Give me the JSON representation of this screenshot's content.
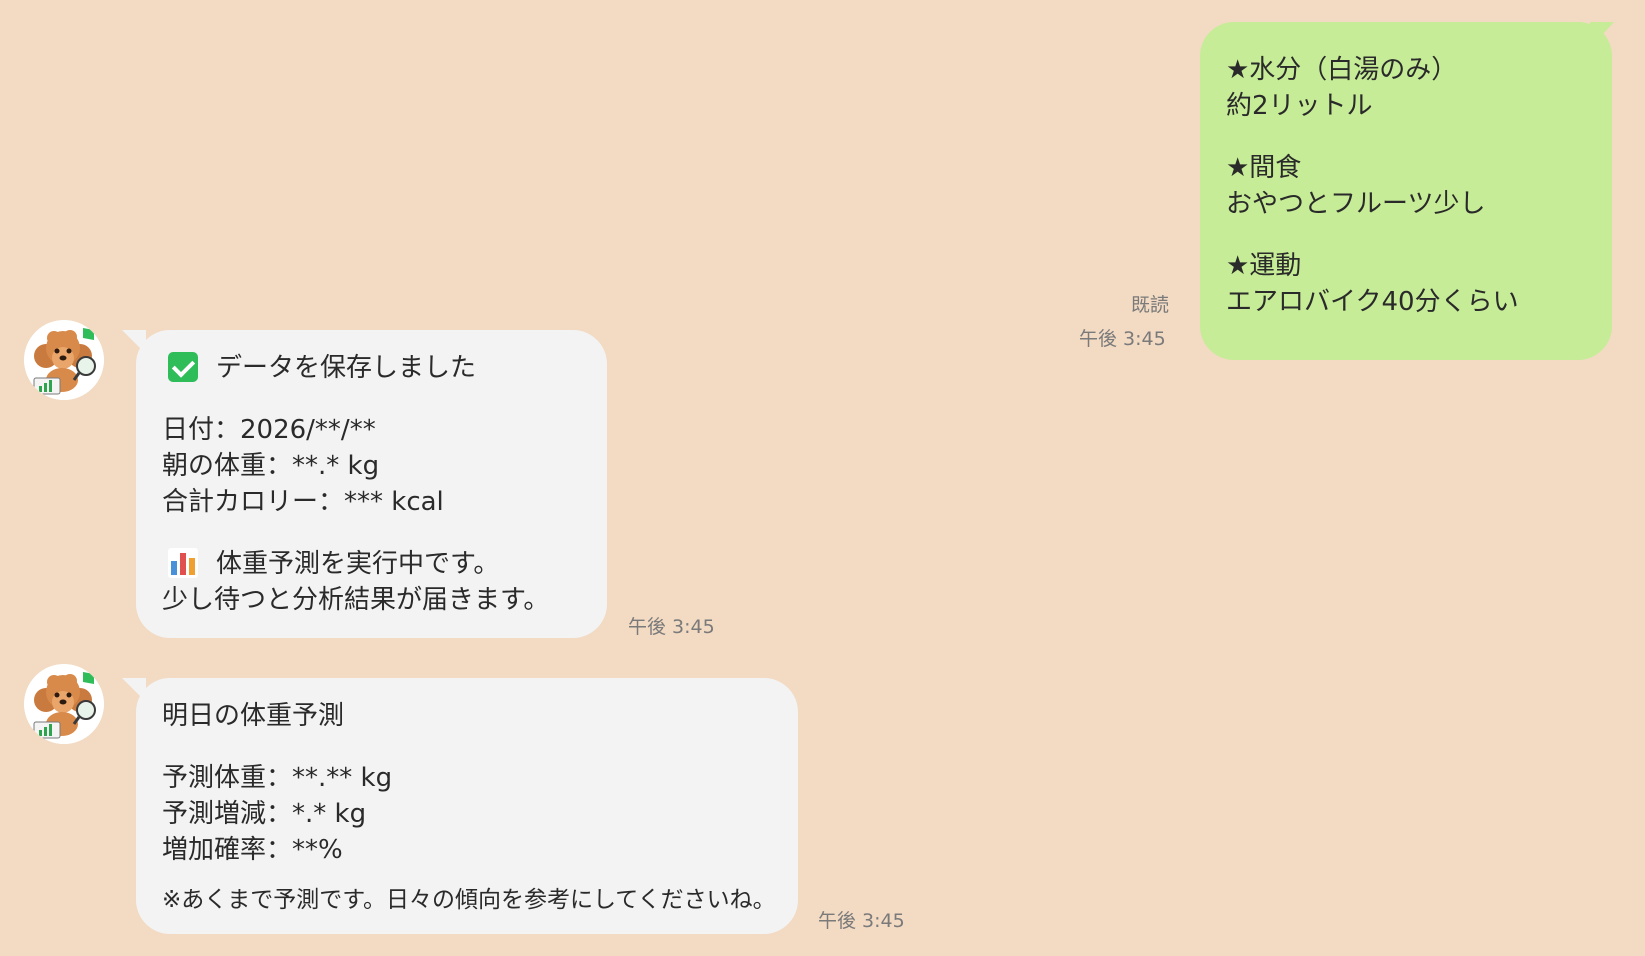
{
  "outgoing": {
    "lines": [
      "★水分（白湯のみ）",
      "約2リットル",
      "",
      "★間食",
      "おやつとフルーツ少し",
      "",
      "★運動",
      "エアロバイク40分くらい"
    ],
    "read_label": "既読",
    "time": "午後 3:45",
    "color": "#c6ec97"
  },
  "bot_message_1": {
    "title": "データを保存しました",
    "title_icon": "check-mark-icon",
    "lines": [
      "日付：2026/**/**",
      "朝の体重：**.* kg",
      "合計カロリー：*** kcal"
    ],
    "status_icon": "bar-chart-icon",
    "status_line": "体重予測を実行中です。",
    "status_line_2": "少し待つと分析結果が届きます。",
    "time": "午後 3:45"
  },
  "bot_message_2": {
    "title": "明日の体重予測",
    "lines": [
      "予測体重：**.** kg",
      "予測増減：*.* kg",
      "増加確率：**%"
    ],
    "note": "※あくまで予測です。日々の傾向を参考にしてくださいね。",
    "time": "午後 3:45"
  },
  "avatar": {
    "icon": "toy-poodle-mascot-icon"
  },
  "colors": {
    "background": "#f2dac3",
    "incoming_bubble": "#f3f3f3",
    "check": "#2fbd5a"
  }
}
